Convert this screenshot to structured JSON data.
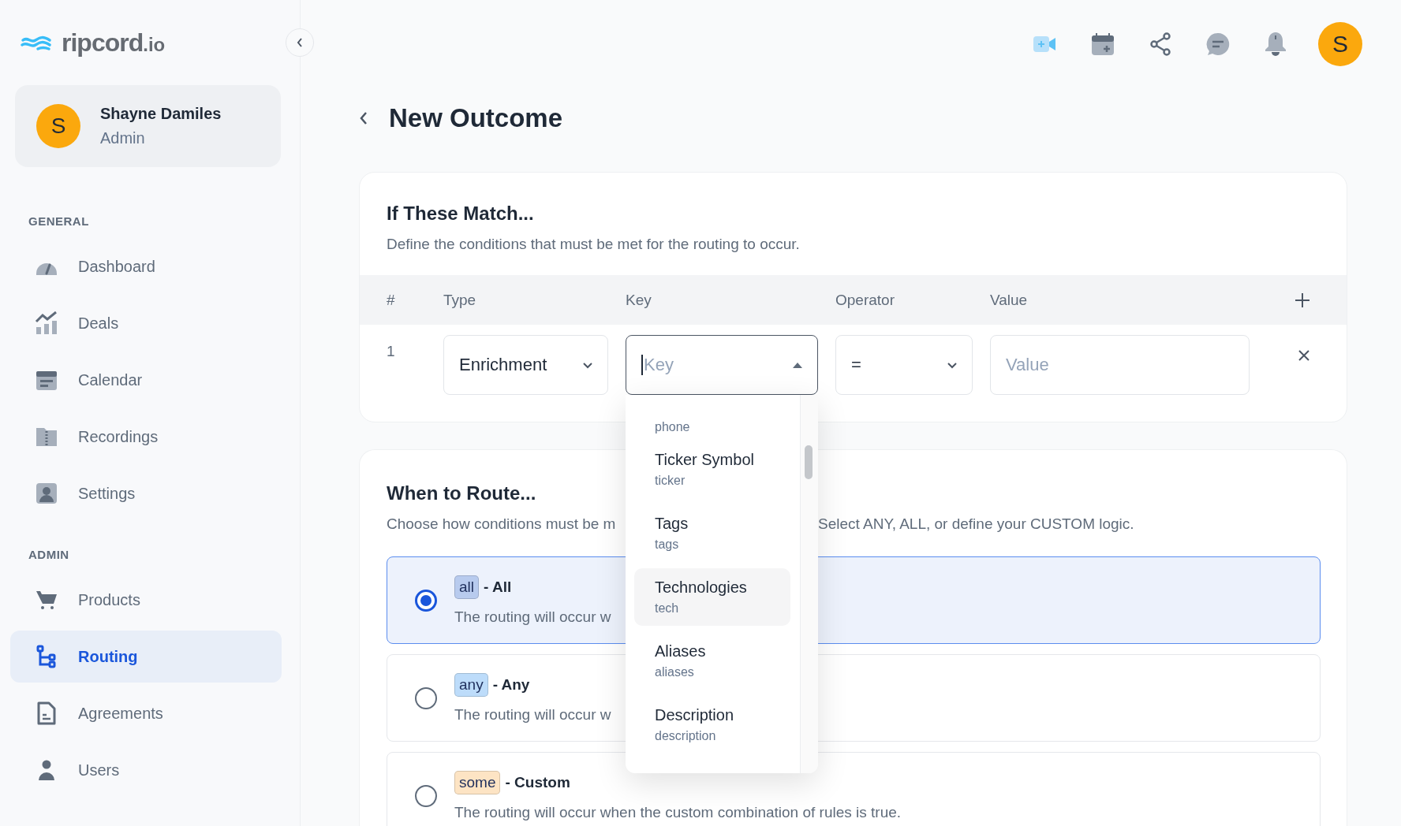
{
  "logo": {
    "text": "ripcord",
    "suffix": ".io"
  },
  "user": {
    "initial": "S",
    "name": "Shayne Damiles",
    "role": "Admin"
  },
  "sidebar": {
    "sections": [
      {
        "title": "GENERAL",
        "items": [
          {
            "label": "Dashboard",
            "selected": false
          },
          {
            "label": "Deals",
            "selected": false
          },
          {
            "label": "Calendar",
            "selected": false
          },
          {
            "label": "Recordings",
            "selected": false
          },
          {
            "label": "Settings",
            "selected": false
          }
        ]
      },
      {
        "title": "ADMIN",
        "items": [
          {
            "label": "Products",
            "selected": false
          },
          {
            "label": "Routing",
            "selected": true
          },
          {
            "label": "Agreements",
            "selected": false
          },
          {
            "label": "Users",
            "selected": false
          }
        ]
      }
    ]
  },
  "header": {
    "avatar_initial": "S"
  },
  "page": {
    "title": "New Outcome"
  },
  "conditions": {
    "title": "If These Match...",
    "subtitle": "Define the conditions that must be met for the routing to occur.",
    "columns": [
      "#",
      "Type",
      "Key",
      "Operator",
      "Value"
    ],
    "rows": [
      {
        "index": "1",
        "type": "Enrichment",
        "key": {
          "placeholder": "Key",
          "expanded": true
        },
        "operator": "=",
        "value": {
          "placeholder": "Value"
        }
      }
    ],
    "key_options": [
      {
        "key": "phone",
        "highlighted": false
      },
      {
        "label": "Ticker Symbol",
        "key": "ticker",
        "highlighted": false
      },
      {
        "label": "Tags",
        "key": "tags",
        "highlighted": false
      },
      {
        "label": "Technologies",
        "key": "tech",
        "highlighted": true
      },
      {
        "label": "Aliases",
        "key": "aliases",
        "highlighted": false
      },
      {
        "label": "Description",
        "key": "description",
        "highlighted": false
      }
    ]
  },
  "routing": {
    "title": "When to Route...",
    "subtitle_parts": [
      "Choose how conditions must be m",
      "Select ANY, ALL, or define your CUSTOM logic."
    ],
    "options": [
      {
        "tag": "all",
        "color": "#b8cbee",
        "label": "- All",
        "description": "The routing will occur w",
        "selected": true
      },
      {
        "tag": "any",
        "color": "#bddcfa",
        "label": "- Any",
        "description": "The routing will occur w",
        "selected": false
      },
      {
        "tag": "some",
        "color": "#fde4c4",
        "label": "- Custom",
        "description": "The routing will occur when the custom combination of rules is true.",
        "selected": false
      }
    ]
  }
}
